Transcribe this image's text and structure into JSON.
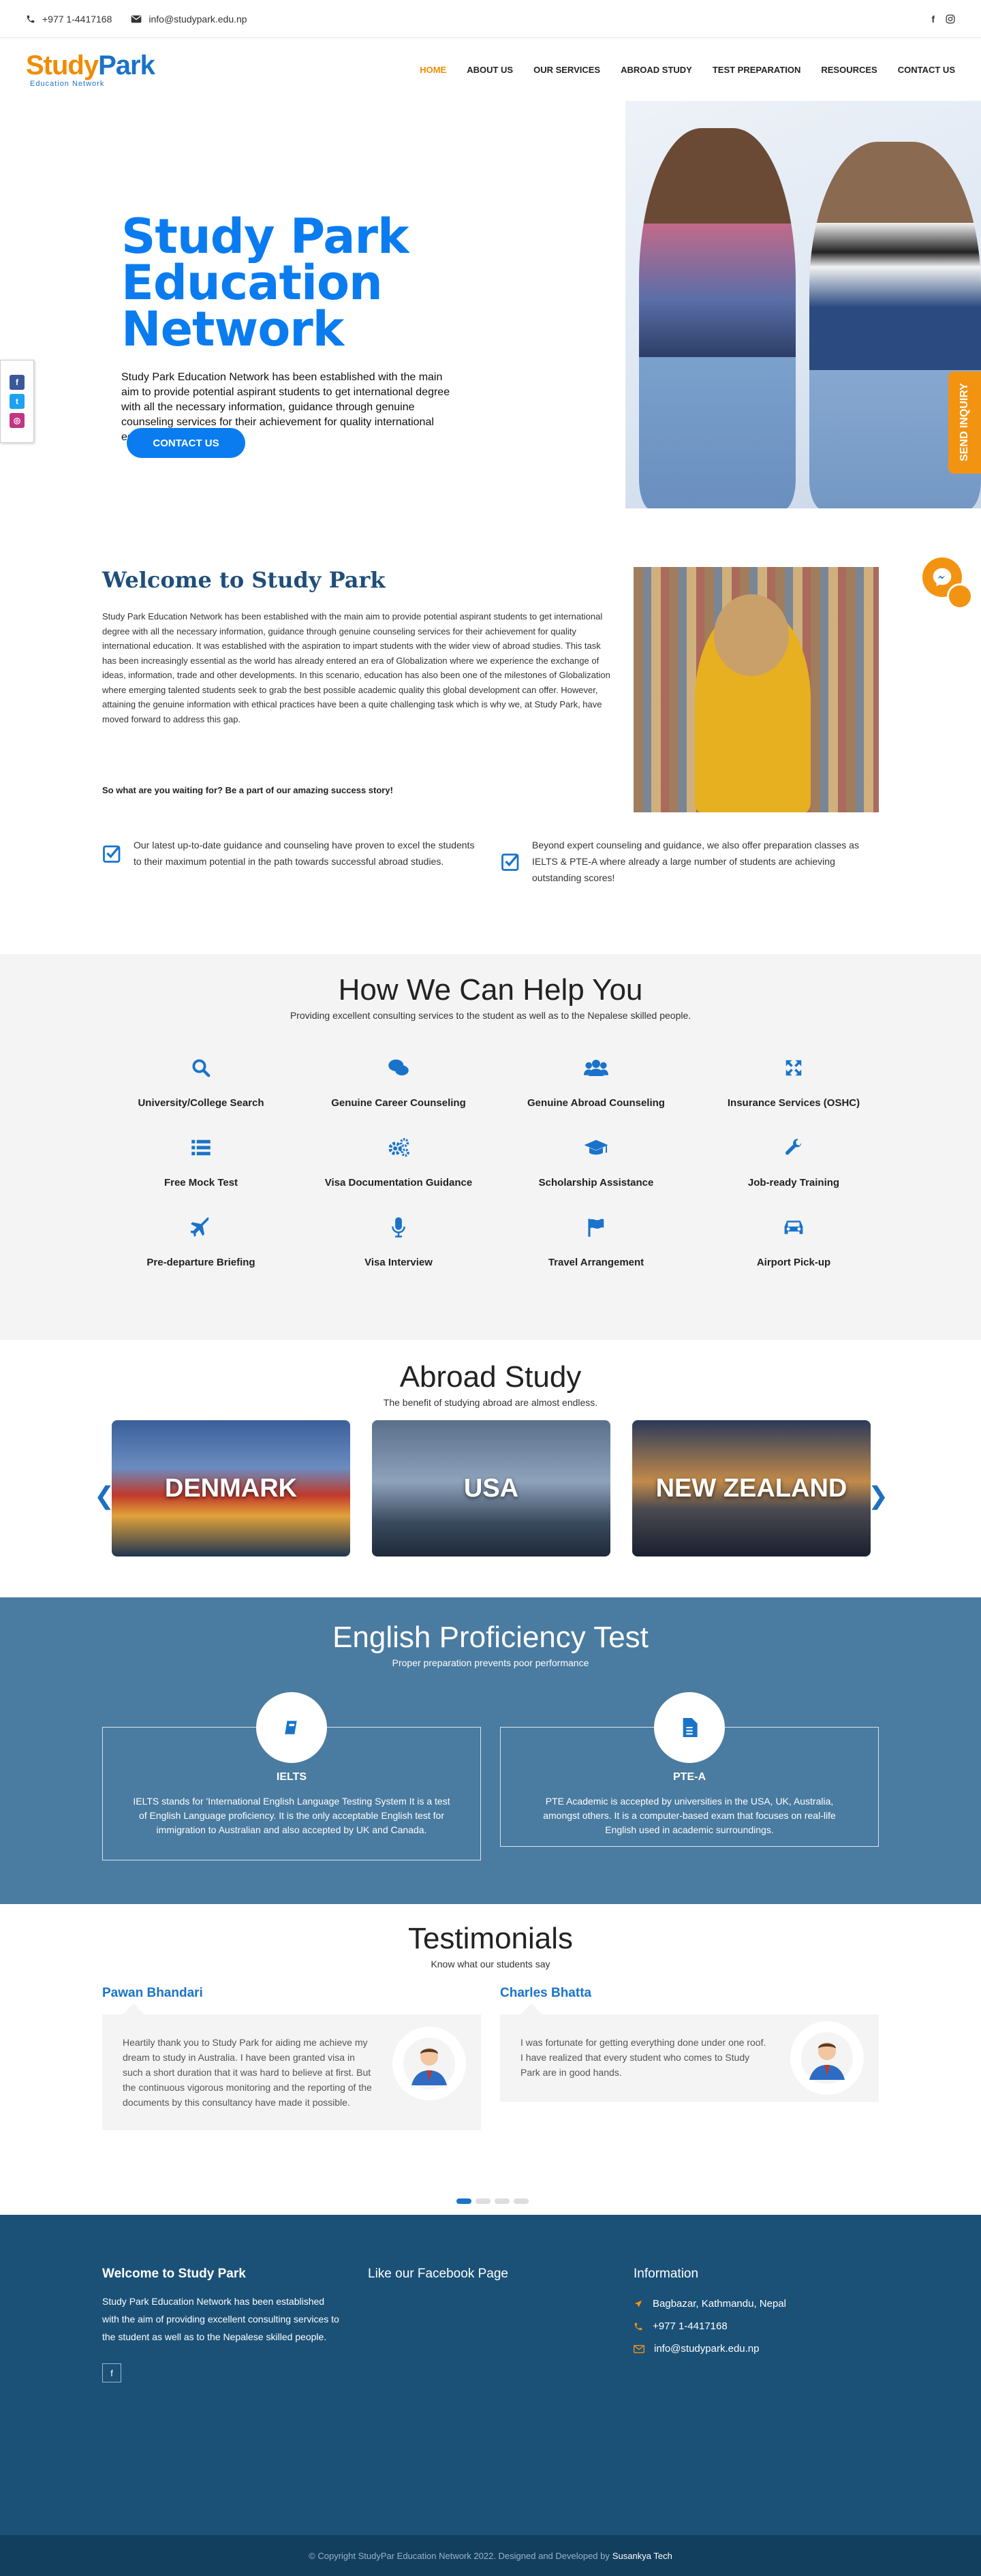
{
  "topbar": {
    "phone": "+977 1-4417168",
    "email": "info@studypark.edu.np"
  },
  "logo": {
    "word1": "Study",
    "word2": "Park",
    "tagline": "Education Network"
  },
  "nav": [
    "HOME",
    "ABOUT US",
    "OUR SERVICES",
    "ABROAD STUDY",
    "TEST PREPARATION",
    "RESOURCES",
    "CONTACT US"
  ],
  "hero": {
    "title_line1": "Study Park",
    "title_line2": "Education Network",
    "desc": "Study Park Education Network has been established with the main aim to provide potential aspirant students to get international degree with all the necessary information, guidance through genuine counseling services for their achievement for quality international education.",
    "button": "CONTACT US"
  },
  "inquiry_tab": "SEND INQUIRY",
  "welcome": {
    "title": "Welcome to Study Park",
    "body": "Study Park Education Network has been established with the main aim to provide potential aspirant students to get international degree with all the necessary information, guidance through genuine counseling services for their achievement for quality international education. It was established with the aspiration to impart students with the wider view of abroad studies. This task has been increasingly essential as the world has already entered an era of Globalization where we experience the exchange of ideas, information, trade and other developments. In this scenario, education has also been one of the milestones of Globalization where emerging talented students seek to grab the best possible academic quality this global development can offer. However, attaining the genuine information with ethical practices have been a quite challenging task which is why we, at Study Park, have moved forward to address this gap.",
    "cta": "So what are you waiting for? Be a part of our amazing success story!",
    "check1": "Our latest up-to-date guidance and counseling have proven to excel the students to their maximum potential in the path towards successful abroad studies.",
    "check2": "Beyond expert counseling and guidance, we also offer preparation classes as IELTS & PTE-A where already a large number of students are achieving outstanding scores!"
  },
  "help": {
    "title": "How We Can Help You",
    "subtitle": "Providing excellent consulting services to the student as well as to the Nepalese skilled people.",
    "items": [
      {
        "label": "University/College Search",
        "icon": "search-icon"
      },
      {
        "label": "Genuine Career Counseling",
        "icon": "chat-icon"
      },
      {
        "label": "Genuine Abroad Counseling",
        "icon": "users-icon"
      },
      {
        "label": "Insurance Services (OSHC)",
        "icon": "expand-icon"
      },
      {
        "label": "Free Mock Test",
        "icon": "list-icon"
      },
      {
        "label": "Visa Documentation Guidance",
        "icon": "gears-icon"
      },
      {
        "label": "Scholarship Assistance",
        "icon": "graduation-cap-icon"
      },
      {
        "label": "Job-ready Training",
        "icon": "wrench-icon"
      },
      {
        "label": "Pre-departure Briefing",
        "icon": "plane-icon"
      },
      {
        "label": "Visa Interview",
        "icon": "microphone-icon"
      },
      {
        "label": "Travel Arrangement",
        "icon": "flag-icon"
      },
      {
        "label": "Airport Pick-up",
        "icon": "car-icon"
      }
    ]
  },
  "abroad": {
    "title": "Abroad Study",
    "subtitle": "The benefit of studying abroad are almost endless.",
    "countries": [
      "DENMARK",
      "USA",
      "NEW ZEALAND"
    ]
  },
  "english": {
    "title": "English Proficiency Test",
    "subtitle": "Proper preparation prevents poor performance",
    "tests": [
      {
        "name": "IELTS",
        "desc": "IELTS stands for 'International English Language Testing System It is a test of English Language proficiency. It is the only acceptable English test for immigration to Australian and also accepted by UK and Canada."
      },
      {
        "name": "PTE-A",
        "desc": "PTE Academic is accepted by universities in the USA, UK, Australia, amongst others. It is a computer-based exam that focuses on real-life English used in academic surroundings."
      }
    ]
  },
  "testimonials": {
    "title": "Testimonials",
    "subtitle": "Know what our students say",
    "items": [
      {
        "name": "Pawan Bhandari",
        "text": "Heartily thank you to Study Park for aiding me achieve my dream to study in Australia. I have been granted visa in such a short duration that it was hard to believe at first. But the continuous vigorous monitoring and the reporting of the documents by this consultancy have made it possible."
      },
      {
        "name": "Charles Bhatta",
        "text": "I was fortunate for getting everything done under one roof. I have realized that every student who comes to Study Park are in good hands."
      }
    ]
  },
  "footer": {
    "col1_title": "Welcome to Study Park",
    "col1_text": "Study Park Education Network has been established with the aim of providing excellent consulting services to the student as well as to the Nepalese skilled people.",
    "col2_title": "Like our Facebook Page",
    "col3_title": "Information",
    "address": "Bagbazar, Kathmandu, Nepal",
    "phone": "+977 1-4417168",
    "email": "info@studypark.edu.np",
    "fb": "f"
  },
  "copyright": {
    "text": "© Copyright StudyPar Education Network 2022. Designed and Developed by",
    "dev": "Susankya Tech"
  },
  "colors": {
    "primary": "#0a7cf0",
    "accent": "#f39312",
    "navy": "#1b5177",
    "steel": "#4a7ba0"
  }
}
